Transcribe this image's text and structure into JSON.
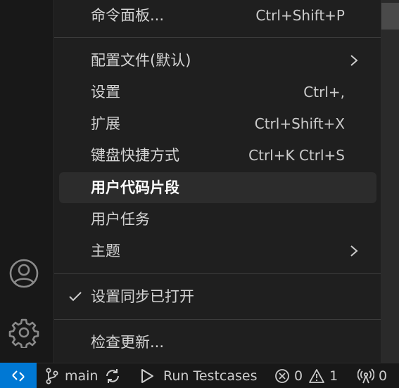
{
  "menu": {
    "items": [
      {
        "label": "命令面板...",
        "shortcut": "Ctrl+Shift+P"
      },
      {
        "label": "配置文件(默认)",
        "shortcut": ""
      },
      {
        "label": "设置",
        "shortcut": "Ctrl+,"
      },
      {
        "label": "扩展",
        "shortcut": "Ctrl+Shift+X"
      },
      {
        "label": "键盘快捷方式",
        "shortcut": "Ctrl+K Ctrl+S"
      },
      {
        "label": "用户代码片段",
        "shortcut": ""
      },
      {
        "label": "用户任务",
        "shortcut": ""
      },
      {
        "label": "主题",
        "shortcut": ""
      },
      {
        "label": "设置同步已打开",
        "shortcut": ""
      },
      {
        "label": "检查更新...",
        "shortcut": ""
      }
    ]
  },
  "status_bar": {
    "branch": "main",
    "run_testcases": "Run Testcases",
    "errors": "0",
    "warnings": "1",
    "ports": "0"
  },
  "icons": {
    "activity_account": "account-icon",
    "activity_manage": "gear-icon",
    "remote": "remote-icon"
  },
  "colors": {
    "accent": "#0078d4",
    "menu_bg": "#1f1f1f",
    "highlight_bg": "#2c2c2c",
    "text": "#d4d4d4"
  }
}
